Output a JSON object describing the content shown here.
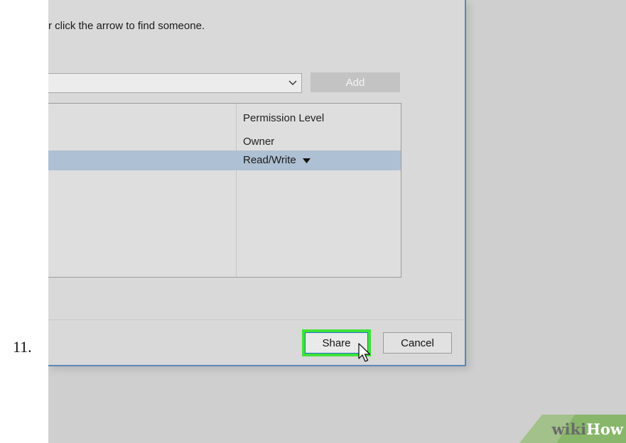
{
  "step": {
    "number": "11."
  },
  "dialog": {
    "instruction": "r click the arrow to find someone.",
    "combo_value": "",
    "add_label": "Add",
    "table": {
      "header": "Permission Level",
      "rows": [
        {
          "permission": "Owner",
          "selected": false
        },
        {
          "permission": "Read/Write",
          "selected": true
        }
      ]
    },
    "share_label": "Share",
    "cancel_label": "Cancel"
  },
  "icons": {
    "combo_arrow": "chevron-down-icon",
    "row_dropdown": "caret-down-icon",
    "cursor": "mouse-pointer-icon"
  },
  "watermark": {
    "part1": "wiki",
    "part2": "How"
  },
  "colors": {
    "highlight": "#3fe23a",
    "selection": "#aec0d3",
    "dialog_border": "#5b87b8"
  }
}
